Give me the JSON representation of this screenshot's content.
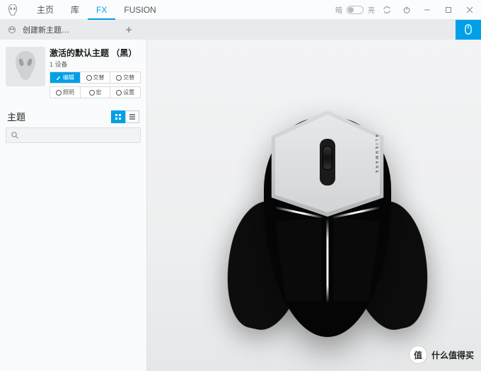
{
  "titlebar": {
    "tabs": [
      "主页",
      "库",
      "FX",
      "FUSION"
    ],
    "active_index": 2,
    "brightness": {
      "dark_label": "暗",
      "light_label": "亮"
    }
  },
  "subbar": {
    "create_label": "创建新主题…"
  },
  "card": {
    "title": "激活的默认主题 （黑）",
    "subtitle": "1 设备",
    "row1": [
      "编辑",
      "交替",
      "交替"
    ],
    "row2": [
      "照明",
      "宏",
      "设置"
    ]
  },
  "theme_header": {
    "title": "主题"
  },
  "search": {
    "placeholder": ""
  },
  "device": {
    "brand": "ALIENWARE"
  },
  "watermark": {
    "badge": "值",
    "text": "什么值得买"
  },
  "colors": {
    "accent": "#00a0e6"
  }
}
